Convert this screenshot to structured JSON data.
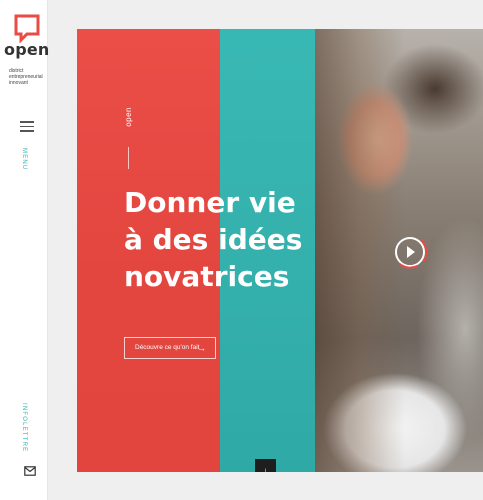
{
  "brand": {
    "name": "open",
    "tagline_lines": [
      "district",
      "entrepreneurial",
      "innovant"
    ],
    "accent_red": "#e84c45",
    "accent_teal": "#35b3af"
  },
  "sidebar": {
    "menu_icon": "hamburger-icon",
    "menu_label": "MENU",
    "newsletter_label": "INFOLETTRE",
    "mail_icon": "envelope-icon"
  },
  "hero": {
    "vertical_brand": "open",
    "headline": "Donner vie à des idées novatrices",
    "cta_label": "Découvre ce qu'on fait",
    "cta_icon": "arrow-right-icon",
    "play_icon": "play-icon",
    "scroll_icon": "arrow-down-icon"
  }
}
